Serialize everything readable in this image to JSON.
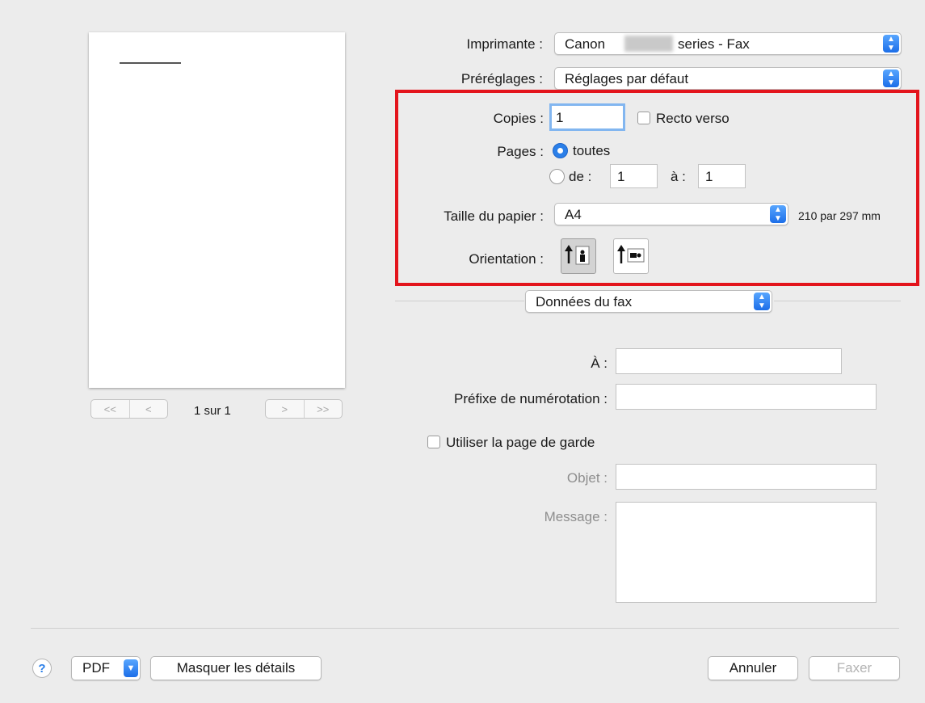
{
  "preview": {
    "nav_first": "<<",
    "nav_prev": "<",
    "nav_next": ">",
    "nav_last": ">>",
    "page_info": "1 sur 1"
  },
  "printer": {
    "label": "Imprimante :",
    "value_prefix": "Canon",
    "value_suffix": "series - Fax"
  },
  "presets": {
    "label": "Préréglages :",
    "value": "Réglages par défaut"
  },
  "copies": {
    "label": "Copies :",
    "value": "1",
    "duplex_label": "Recto verso",
    "duplex_checked": false
  },
  "pages": {
    "label": "Pages :",
    "all_label": "toutes",
    "selected": "all",
    "range_from_label": "de :",
    "range_from": "1",
    "range_to_label": "à :",
    "range_to": "1"
  },
  "paper_size": {
    "label": "Taille du papier :",
    "value": "A4",
    "dimensions": "210 par 297 mm"
  },
  "orientation": {
    "label": "Orientation :",
    "selected": "portrait",
    "options": [
      "portrait",
      "landscape"
    ]
  },
  "section": {
    "value": "Données du fax"
  },
  "fax": {
    "to_label": "À :",
    "to_value": "",
    "prefix_label": "Préfixe de numérotation :",
    "prefix_value": "",
    "cover_page_label": "Utiliser la page de garde",
    "cover_page_checked": false,
    "subject_label": "Objet :",
    "subject_value": "",
    "message_label": "Message :",
    "message_value": ""
  },
  "footer": {
    "help_label": "?",
    "pdf_label": "PDF",
    "hide_details_label": "Masquer les détails",
    "cancel_label": "Annuler",
    "fax_label": "Faxer"
  },
  "colors": {
    "accent": "#2b7fe8",
    "highlight_box": "#e3141c",
    "focus_ring": "#82b6f0"
  },
  "icons": {
    "popup_arrow": "updown-chevron-icon",
    "portrait": "portrait-orientation-icon",
    "landscape": "landscape-orientation-icon"
  }
}
